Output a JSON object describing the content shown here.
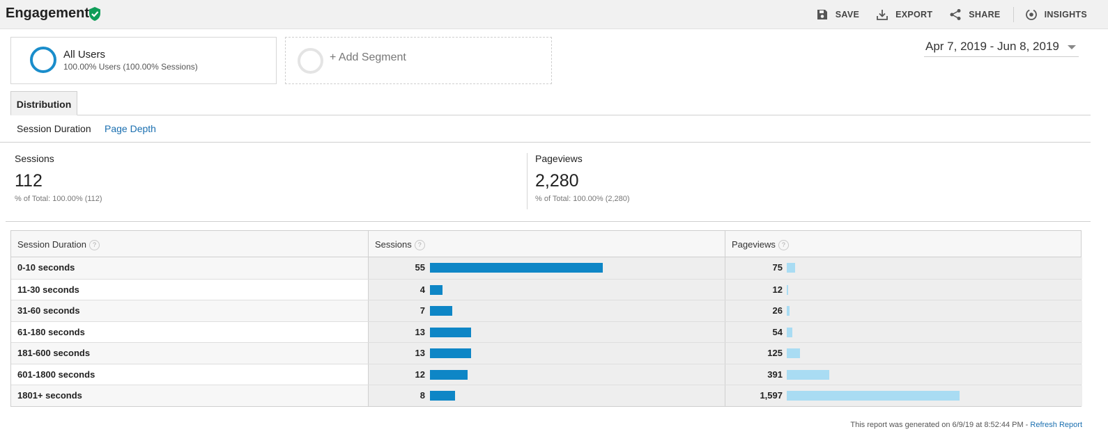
{
  "header": {
    "title": "Engagement",
    "actions": {
      "save": "SAVE",
      "export": "EXPORT",
      "share": "SHARE",
      "insights": "INSIGHTS"
    }
  },
  "segments": {
    "all_users": {
      "name": "All Users",
      "detail": "100.00% Users (100.00% Sessions)"
    },
    "add_segment": "+ Add Segment"
  },
  "date_range": "Apr 7, 2019 - Jun 8, 2019",
  "tabs": {
    "main": "Distribution",
    "sub_active": "Session Duration",
    "sub_link": "Page Depth"
  },
  "scorecards": {
    "sessions": {
      "label": "Sessions",
      "value": "112",
      "subtext": "% of Total: 100.00% (112)"
    },
    "pageviews": {
      "label": "Pageviews",
      "value": "2,280",
      "subtext": "% of Total: 100.00% (2,280)"
    }
  },
  "table": {
    "columns": [
      "Session Duration",
      "Sessions",
      "Pageviews"
    ],
    "help_glyph": "?",
    "rows": [
      {
        "duration": "0-10 seconds",
        "sessions": "55",
        "pageviews": "75"
      },
      {
        "duration": "11-30 seconds",
        "sessions": "4",
        "pageviews": "12"
      },
      {
        "duration": "31-60 seconds",
        "sessions": "7",
        "pageviews": "26"
      },
      {
        "duration": "61-180 seconds",
        "sessions": "13",
        "pageviews": "54"
      },
      {
        "duration": "181-600 seconds",
        "sessions": "13",
        "pageviews": "125"
      },
      {
        "duration": "601-1800 seconds",
        "sessions": "12",
        "pageviews": "391"
      },
      {
        "duration": "1801+ seconds",
        "sessions": "8",
        "pageviews": "1,597"
      }
    ]
  },
  "footer": {
    "generated": "This report was generated on 6/9/19 at 8:52:44 PM - ",
    "refresh": "Refresh Report"
  },
  "colors": {
    "accent": "#0e86c6",
    "pageview_bar": "#a9dcf3",
    "verified_green": "#0f9d58",
    "link": "#1a6fb0"
  }
}
